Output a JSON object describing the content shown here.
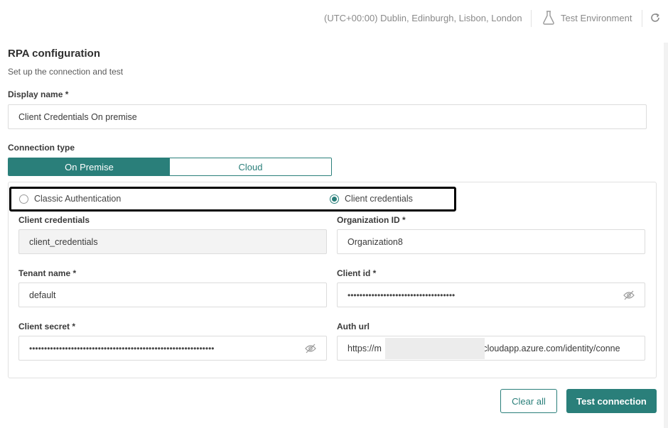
{
  "header": {
    "timezone": "(UTC+00:00) Dublin, Edinburgh, Lisbon, London",
    "environment": "Test Environment"
  },
  "page": {
    "title": "RPA configuration",
    "subtitle": "Set up the connection and test"
  },
  "form": {
    "display_name": {
      "label": "Display name *",
      "value": "Client Credentials On premise"
    },
    "connection_type": {
      "label": "Connection type",
      "options": [
        "On Premise",
        "Cloud"
      ],
      "selected": "On Premise"
    },
    "auth_options": {
      "classic": "Classic Authentication",
      "client_credentials": "Client credentials",
      "selected": "Client credentials"
    },
    "client_credentials": {
      "label": "Client credentials",
      "value": "client_credentials"
    },
    "organization_id": {
      "label": "Organization ID *",
      "value": "Organization8"
    },
    "tenant_name": {
      "label": "Tenant name *",
      "value": "default"
    },
    "client_id": {
      "label": "Client id *",
      "value": "••••••••••••••••••••••••••••••••••••"
    },
    "client_secret": {
      "label": "Client secret *",
      "value": "••••••••••••••••••••••••••••••••••••••••••••••••••••••••••••••"
    },
    "auth_url": {
      "label": "Auth url",
      "value_prefix": "https://m",
      "value_suffix": ".cloudapp.azure.com/identity/conne"
    }
  },
  "actions": {
    "clear_label": "Clear all",
    "test_label": "Test connection"
  },
  "colors": {
    "accent": "#2a7f7a",
    "highlight_border": "#000000"
  }
}
